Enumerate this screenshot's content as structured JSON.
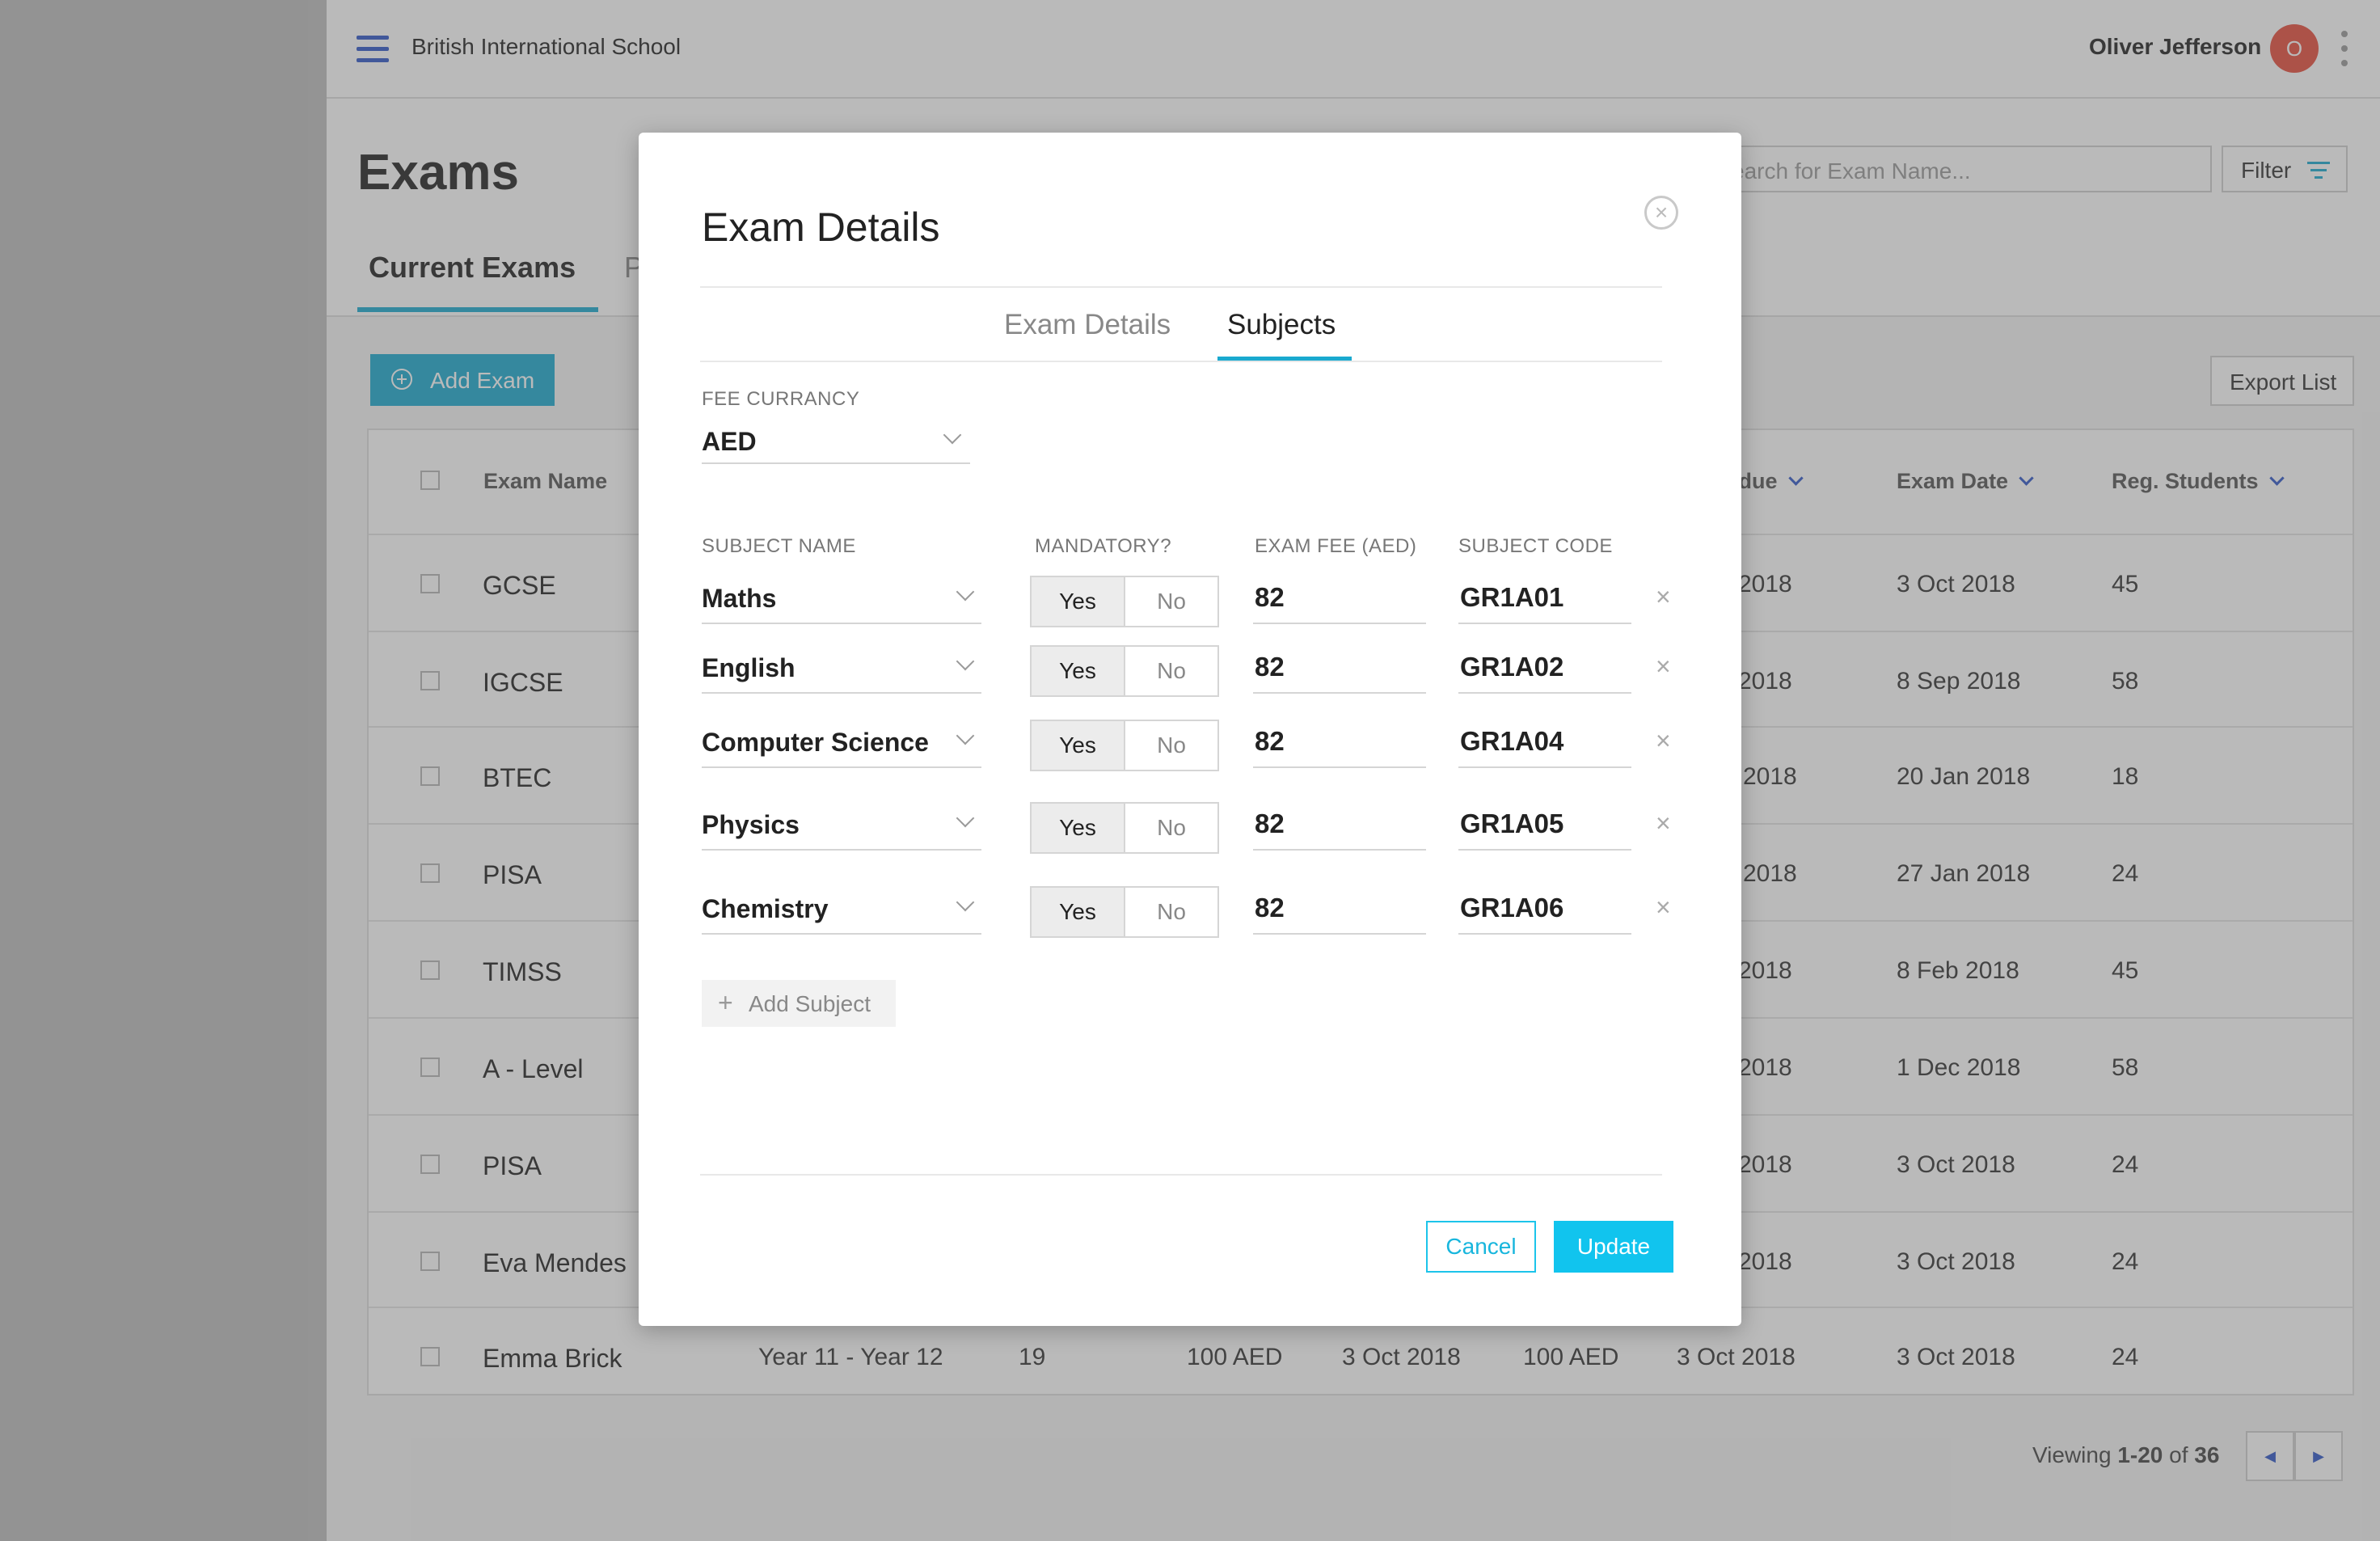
{
  "app": {
    "school_name": "British International School",
    "user_name": "Oliver Jefferson",
    "user_initial": "O",
    "accent_color": "#1aa9cf"
  },
  "page": {
    "title": "Exams",
    "tabs": [
      {
        "label": "Current Exams",
        "active": true
      },
      {
        "label": "P",
        "active": false
      }
    ],
    "search_placeholder": "earch for Exam Name...",
    "filter_label": "Filter",
    "add_exam_label": "Add Exam",
    "export_label": "Export List"
  },
  "table": {
    "headers": {
      "name": "Exam Name",
      "fee_due": "e due",
      "exam_date": "Exam Date",
      "reg_students": "Reg. Students"
    },
    "rows": [
      {
        "name": "GCSE",
        "fee_due": "2018",
        "exam_date": "3 Oct 2018",
        "students": "45"
      },
      {
        "name": "IGCSE",
        "fee_due": "2018",
        "exam_date": "8 Sep 2018",
        "students": "58"
      },
      {
        "name": "BTEC",
        "fee_due": "2018",
        "exam_date": "20 Jan 2018",
        "students": "18"
      },
      {
        "name": "PISA",
        "fee_due": "2018",
        "exam_date": "27 Jan 2018",
        "students": "24"
      },
      {
        "name": "TIMSS",
        "fee_due": "2018",
        "exam_date": "8 Feb 2018",
        "students": "45"
      },
      {
        "name": "A - Level",
        "fee_due": "2018",
        "exam_date": "1 Dec 2018",
        "students": "58"
      },
      {
        "name": "PISA",
        "fee_due": "2018",
        "exam_date": "3 Oct 2018",
        "students": "24"
      },
      {
        "name": "Eva Mendes",
        "fee_due": "2018",
        "exam_date": "3 Oct 2018",
        "students": "24"
      }
    ],
    "last_row": {
      "name": "Emma Brick",
      "years": "Year 11 - Year 12",
      "count": "19",
      "fee1": "100 AED",
      "date1": "3 Oct 2018",
      "fee2": "100 AED",
      "date2": "3 Oct 2018",
      "exam_date": "3 Oct 2018",
      "students": "24"
    }
  },
  "pagination": {
    "prefix": "Viewing ",
    "range": "1-20",
    "middle": " of ",
    "total": "36"
  },
  "modal": {
    "title": "Exam Details",
    "tabs": [
      {
        "label": "Exam Details",
        "active": false
      },
      {
        "label": "Subjects",
        "active": true
      }
    ],
    "currency_label": "FEE CURRANCY",
    "currency_value": "AED",
    "col_subject": "SUBJECT NAME",
    "col_mandatory": "MANDATORY?",
    "col_fee": "EXAM FEE (AED)",
    "col_code": "SUBJECT CODE",
    "yes_label": "Yes",
    "no_label": "No",
    "subjects": [
      {
        "name": "Maths",
        "mandatory": "Yes",
        "fee": "82",
        "code": "GR1A01"
      },
      {
        "name": "English",
        "mandatory": "Yes",
        "fee": "82",
        "code": "GR1A02"
      },
      {
        "name": "Computer Science",
        "mandatory": "Yes",
        "fee": "82",
        "code": "GR1A04"
      },
      {
        "name": "Physics",
        "mandatory": "Yes",
        "fee": "82",
        "code": "GR1A05"
      },
      {
        "name": "Chemistry",
        "mandatory": "Yes",
        "fee": "82",
        "code": "GR1A06"
      }
    ],
    "add_subject_label": "Add Subject",
    "cancel_label": "Cancel",
    "update_label": "Update"
  }
}
